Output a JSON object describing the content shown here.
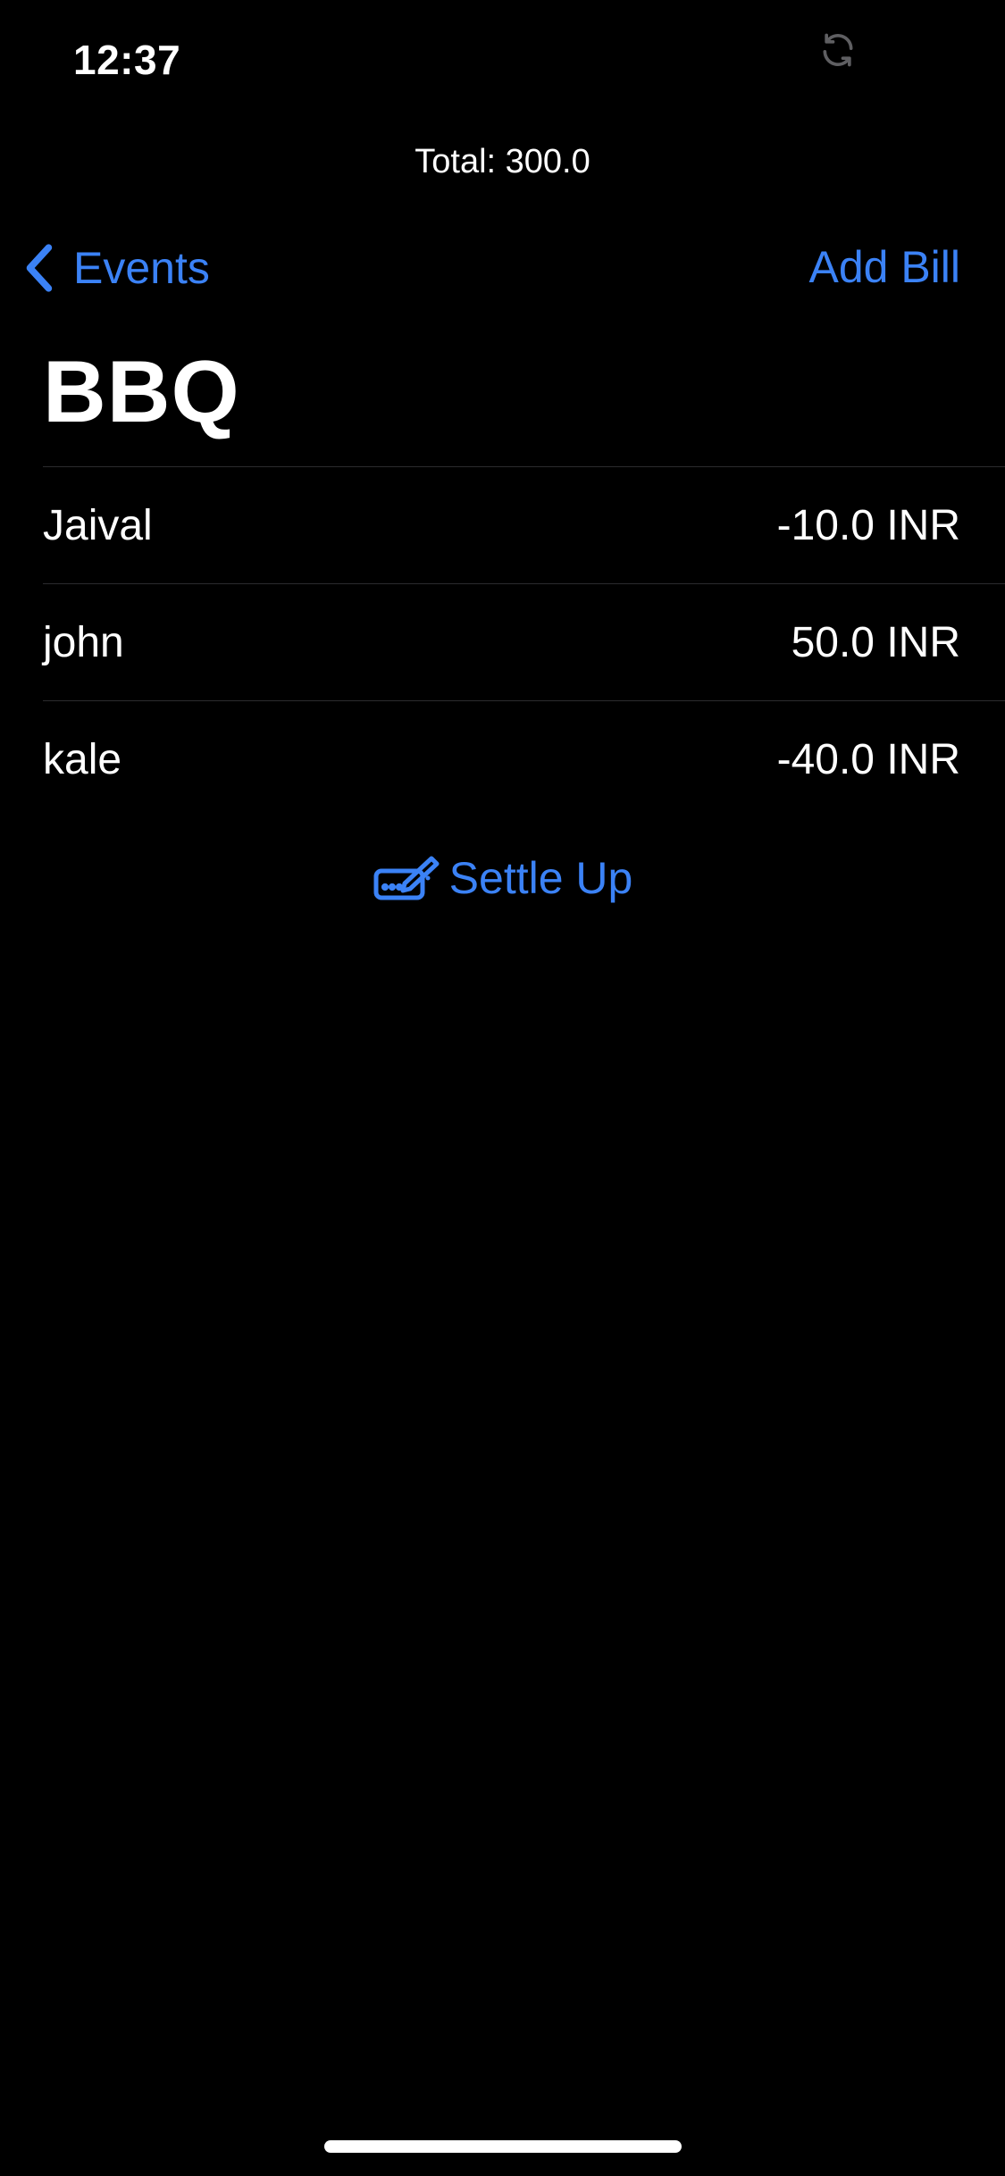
{
  "status_bar": {
    "time": "12:37",
    "sync_icon": "sync-icon"
  },
  "header": {
    "total": "Total: 300.0",
    "back_label": "Events",
    "add_bill_label": "Add Bill",
    "title": "BBQ"
  },
  "balances": [
    {
      "name": "Jaival",
      "amount": "-10.0 INR"
    },
    {
      "name": "john",
      "amount": "50.0 INR"
    },
    {
      "name": "kale",
      "amount": "-40.0 INR"
    }
  ],
  "actions": {
    "settle_label": "Settle Up",
    "settle_icon": "signature-icon"
  },
  "colors": {
    "background": "#000000",
    "accent": "#3b82f6",
    "text": "#ffffff",
    "separator": "#2b2b2e"
  }
}
